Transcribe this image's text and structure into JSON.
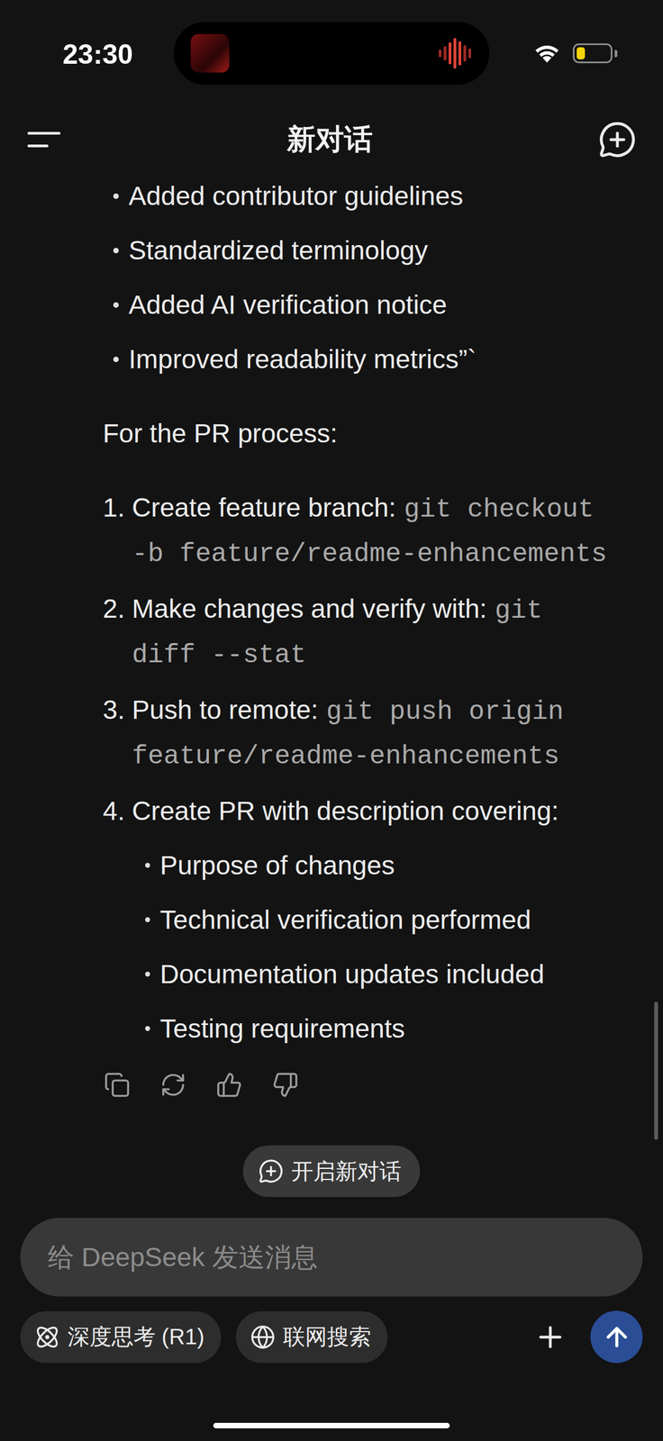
{
  "status_bar": {
    "time": "23:30",
    "battery": {
      "level": 0.25,
      "low_power": true
    }
  },
  "header": {
    "title": "新对话"
  },
  "message": {
    "bullets": [
      "Added contributor guidelines",
      "Standardized terminology",
      "Added AI verification notice",
      "Improved readability metrics”`"
    ],
    "intro": "For the PR process:",
    "steps": [
      {
        "number": "1.",
        "text": "Create feature branch:",
        "code": "git checkout -b feature/readme-enhancements"
      },
      {
        "number": "2.",
        "text": "Make changes and verify with:",
        "code": "git diff --stat"
      },
      {
        "number": "3.",
        "text": "Push to remote:",
        "code": "git push origin feature/readme-enhancements"
      },
      {
        "number": "4.",
        "text": "Create PR with description covering:",
        "items": [
          "Purpose of changes",
          "Technical verification performed",
          "Documentation updates included",
          "Testing requirements"
        ]
      }
    ]
  },
  "new_chat_button": {
    "label": "开启新对话"
  },
  "input": {
    "placeholder": "给 DeepSeek 发送消息"
  },
  "toggles": [
    {
      "label": "深度思考 (R1)",
      "selected": false
    },
    {
      "label": "联网搜索",
      "selected": false
    }
  ]
}
